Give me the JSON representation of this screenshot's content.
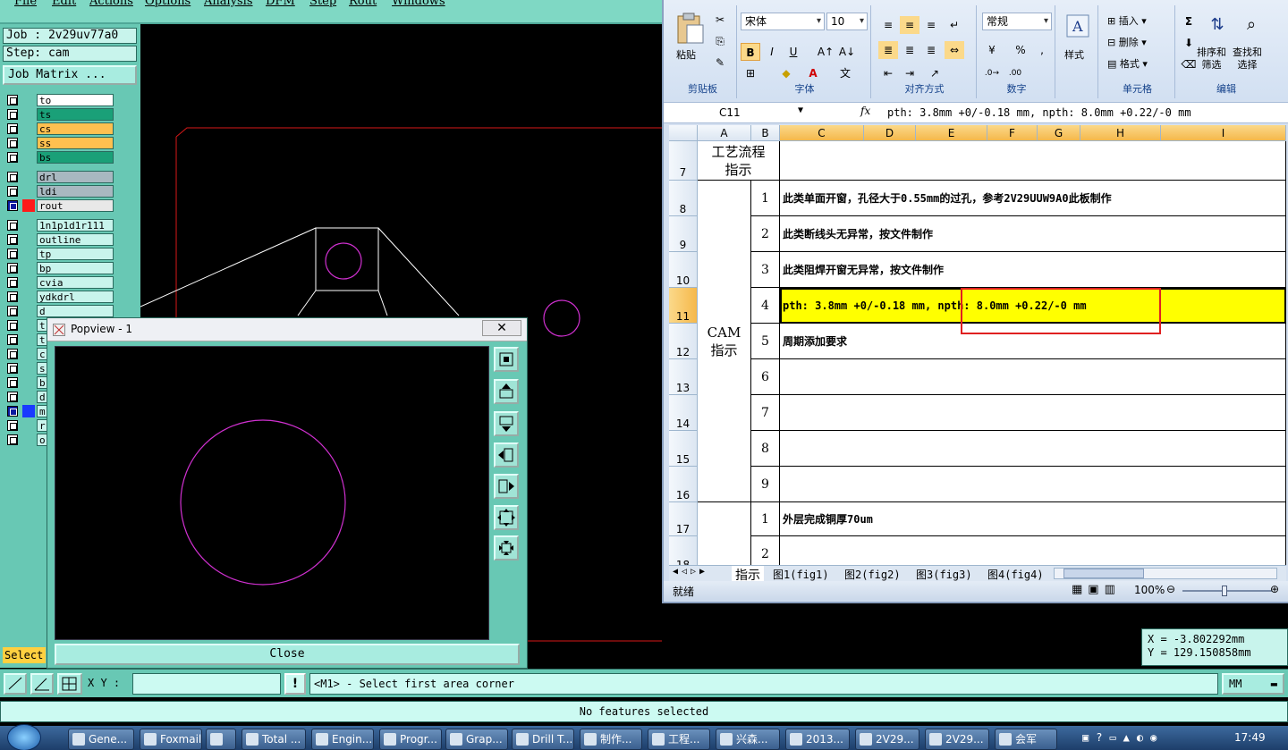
{
  "cam": {
    "menu": [
      "File",
      "Edit",
      "Actions",
      "Options",
      "Analysis",
      "DFM",
      "Step",
      "Rout",
      "Windows"
    ],
    "job_label": "Job : 2v29uv77a0",
    "step_label": "Step: cam",
    "job_matrix": "Job Matrix ...",
    "layers": [
      {
        "name": "to",
        "color": "#ffffff"
      },
      {
        "name": "ts",
        "color": "#1aa078"
      },
      {
        "name": "cs",
        "color": "#ffc050"
      },
      {
        "name": "ss",
        "color": "#ffc050"
      },
      {
        "name": "bs",
        "color": "#1aa078"
      },
      {
        "name": "drl",
        "color": "#a8b8c0"
      },
      {
        "name": "ldi",
        "color": "#a8b8c0"
      },
      {
        "name": "rout",
        "color": "#e8e8e8"
      },
      {
        "name": "1n1p1d1r111",
        "color": "#c8f4ec"
      },
      {
        "name": "outline",
        "color": "#c8f4ec"
      },
      {
        "name": "tp",
        "color": "#c8f4ec"
      },
      {
        "name": "bp",
        "color": "#c8f4ec"
      },
      {
        "name": "cvia",
        "color": "#c8f4ec"
      },
      {
        "name": "ydkdrl",
        "color": "#c8f4ec"
      },
      {
        "name": "d",
        "color": "#c8f4ec"
      },
      {
        "name": "t",
        "color": "#c8f4ec"
      },
      {
        "name": "t",
        "color": "#c8f4ec"
      },
      {
        "name": "c",
        "color": "#c8f4ec"
      },
      {
        "name": "s",
        "color": "#c8f4ec"
      },
      {
        "name": "b",
        "color": "#c8f4ec"
      },
      {
        "name": "d",
        "color": "#c8f4ec"
      },
      {
        "name": "m",
        "color": "#c8f4ec"
      },
      {
        "name": "r",
        "color": "#c8f4ec"
      },
      {
        "name": "o",
        "color": "#c8f4ec"
      }
    ],
    "select_label": "Select",
    "popview_title": "Popview - 1",
    "popview_close_x": "✕",
    "popview_close": "Close",
    "xy_label": "X Y :",
    "xy_value": "",
    "prompt": "<M1> - Select first area corner",
    "units": "MM",
    "coord_x": "X = -3.802292mm",
    "coord_y": "Y = 129.150858mm",
    "status": "No features selected",
    "accent_color": "#68c8b4"
  },
  "excel": {
    "ribbon": {
      "paste": "粘贴",
      "clipboard": "剪贴板",
      "font_name": "宋体",
      "font_size": "10",
      "font_group": "字体",
      "align_group": "对齐方式",
      "number_format": "常规",
      "number_group": "数字",
      "style": "样式",
      "insert": "插入",
      "delete": "删除",
      "format": "格式",
      "cells_group": "单元格",
      "sort_filter": "排序和\n筛选",
      "find_select": "查找和\n选择",
      "edit_group": "编辑",
      "bold": "B",
      "italic": "I",
      "underline": "U",
      "percent": "%",
      "comma": ","
    },
    "name_box": "C11",
    "fx": "fx",
    "formula": "pth:  3.8mm +0/-0.18 mm, npth: 8.0mm +0.22/-0 mm",
    "columns": [
      "A",
      "B",
      "C",
      "D",
      "E",
      "F",
      "G",
      "H",
      "I"
    ],
    "rows": [
      {
        "num": "7",
        "seq": "",
        "text": ""
      },
      {
        "num": "8",
        "seq": "1",
        "text": "此类单面开窗，孔径大于0.55mm的过孔，参考2V29UUW9A0此板制作"
      },
      {
        "num": "9",
        "seq": "2",
        "text": "此类断线头无异常，按文件制作"
      },
      {
        "num": "10",
        "seq": "3",
        "text": "此类阻焊开窗无异常，按文件制作"
      },
      {
        "num": "11",
        "seq": "4",
        "text": "pth:  3.8mm +0/-0.18 mm, npth: 8.0mm +0.22/-0 mm"
      },
      {
        "num": "12",
        "seq": "5",
        "text": "周期添加要求"
      },
      {
        "num": "13",
        "seq": "6",
        "text": ""
      },
      {
        "num": "14",
        "seq": "7",
        "text": ""
      },
      {
        "num": "15",
        "seq": "8",
        "text": ""
      },
      {
        "num": "16",
        "seq": "9",
        "text": ""
      },
      {
        "num": "17",
        "seq": "1",
        "text": "外层完成铜厚70um"
      },
      {
        "num": "18",
        "seq": "2",
        "text": ""
      }
    ],
    "merged_7": "工艺流程\n指示",
    "merged_cam": "CAM\n指示",
    "sheet_tabs": [
      "指示",
      "图1(fig1)",
      "图2(fig2)",
      "图3(fig3)",
      "图4(fig4)"
    ],
    "status_ready": "就绪",
    "zoom": "100%",
    "highlight_color": "#ffff00"
  },
  "taskbar": {
    "items": [
      "Gene...",
      "Foxmail",
      "",
      "Total ...",
      "Engin...",
      "Progr...",
      "Grap...",
      "Drill T...",
      "制作...",
      "工程...",
      "兴森...",
      "2013...",
      "2V29...",
      "2V29...",
      "会军"
    ],
    "clock": "17:49"
  }
}
